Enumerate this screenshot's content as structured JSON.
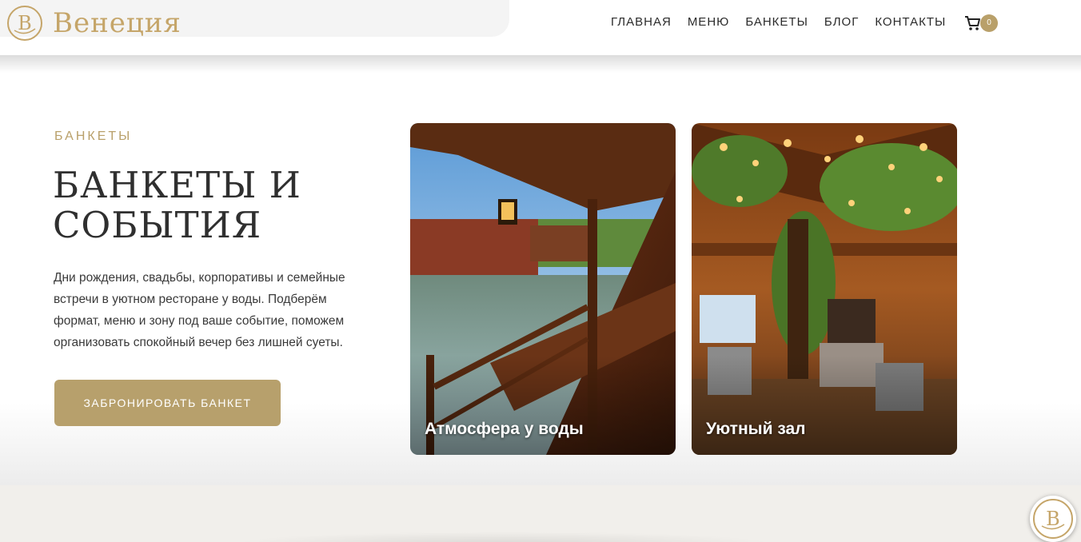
{
  "header": {
    "logo_text": "Венеция",
    "logo_monogram": "В",
    "nav": [
      {
        "label": "ГЛАВНАЯ"
      },
      {
        "label": "МЕНЮ"
      },
      {
        "label": "БАНКЕТЫ"
      },
      {
        "label": "БЛОГ"
      },
      {
        "label": "КОНТАКТЫ"
      }
    ],
    "cart_count": "0",
    "cart_icon": "cart-icon"
  },
  "hero": {
    "eyebrow": "БАНКЕТЫ",
    "title_line1": "БАНКЕТЫ И",
    "title_line2": "СОБЫТИЯ",
    "description": "Дни рождения, свадьбы, корпоративы и семейные встречи в уютном ресторане у воды. Подберём формат, меню и зону под ваше событие, поможем организовать спокойный вечер без лишней суеты.",
    "cta_label": "ЗАБРОНИРОВАТЬ БАНКЕТ",
    "cards": [
      {
        "label": "Атмосфера у воды"
      },
      {
        "label": "Уютный зал"
      }
    ]
  },
  "fab": {
    "monogram": "В"
  },
  "colors": {
    "accent": "#b7a06c",
    "logo": "#c5a569",
    "text": "#2f2f2f"
  }
}
